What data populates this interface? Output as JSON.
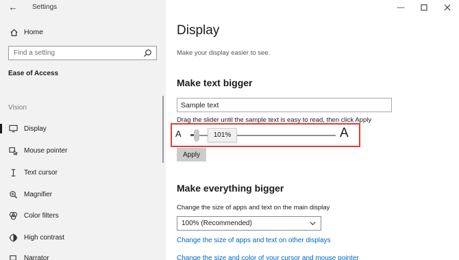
{
  "window": {
    "title": "Settings",
    "controls": [
      "minimize",
      "maximize",
      "close"
    ]
  },
  "sidebar": {
    "home_label": "Home",
    "search_placeholder": "Find a setting",
    "category": "Ease of Access",
    "group_label": "Vision",
    "items": [
      {
        "label": "Display",
        "icon": "monitor-icon",
        "active": true
      },
      {
        "label": "Mouse pointer",
        "icon": "mouse-pointer-icon",
        "active": false
      },
      {
        "label": "Text cursor",
        "icon": "text-cursor-icon",
        "active": false
      },
      {
        "label": "Magnifier",
        "icon": "magnifier-icon",
        "active": false
      },
      {
        "label": "Color filters",
        "icon": "color-filters-icon",
        "active": false
      },
      {
        "label": "High contrast",
        "icon": "high-contrast-icon",
        "active": false
      },
      {
        "label": "Narrator",
        "icon": "narrator-icon",
        "active": false
      }
    ]
  },
  "main": {
    "title": "Display",
    "subtitle": "Make your display easier to see.",
    "text_bigger": {
      "heading": "Make text bigger",
      "sample_text": "Sample text",
      "instruction": "Drag the slider until the sample text is easy to read, then click Apply",
      "slider": {
        "min_glyph": "A",
        "max_glyph": "A",
        "value_label": "101%",
        "value_fraction": 0.01
      },
      "apply_label": "Apply"
    },
    "everything_bigger": {
      "heading": "Make everything bigger",
      "size_label": "Change the size of apps and text on the main display",
      "selected_option": "100% (Recommended)",
      "link_other_displays": "Change the size of apps and text on other displays",
      "link_cursor": "Change the size and color of your cursor and mouse pointer"
    }
  },
  "colors": {
    "accent_link": "#0067c0",
    "highlight_frame": "#e53935",
    "sidebar_bg": "#f2f2f2"
  }
}
